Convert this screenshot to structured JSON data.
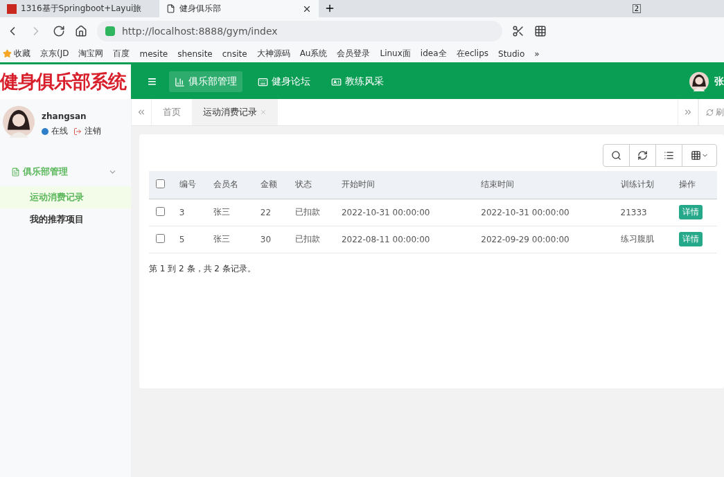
{
  "browser": {
    "tabs": [
      {
        "label": "1316基于Springboot+Layui旅",
        "selected": false
      },
      {
        "label": "健身俱乐部",
        "selected": true
      }
    ],
    "tab_count": "2",
    "address": "http://localhost:8888/gym/index",
    "bookmarks": [
      "收藏",
      "京东(JD",
      "淘宝网",
      "百度",
      "mesite",
      "shensite",
      "cnsite",
      "大神源码",
      "Au系统",
      "会员登录",
      "Linux面",
      "idea全",
      "在eclips",
      "Studio",
      "»"
    ]
  },
  "app": {
    "logo": "健身俱乐部系统",
    "menu_icon": "≡",
    "top_nav": [
      {
        "label": "俱乐部管理",
        "selected": true
      },
      {
        "label": "健身论坛",
        "selected": false
      },
      {
        "label": "教练风采",
        "selected": false
      }
    ],
    "user_name": "张",
    "sidebar": {
      "username": "zhangsan",
      "status": "在线",
      "logout": "注销",
      "items": [
        {
          "label": "俱乐部管理",
          "expanded": true,
          "children": [
            {
              "label": "运动消费记录",
              "selected": true
            },
            {
              "label": "我的推荐项目",
              "selected": false
            }
          ]
        }
      ]
    },
    "page_tabs": [
      {
        "label": "首页",
        "selected": false
      },
      {
        "label": "运动消费记录",
        "selected": true
      }
    ],
    "refresh": "刷",
    "table": {
      "select_all": false,
      "columns": [
        "编号",
        "会员名",
        "金额",
        "状态",
        "开始时间",
        "结束时间",
        "训练计划",
        "操作"
      ],
      "rows": [
        {
          "checked": false,
          "cells": [
            "3",
            "张三",
            "22",
            "已扣款",
            "2022-10-31 00:00:00",
            "2022-10-31 00:00:00",
            "21333"
          ],
          "action": "详情"
        },
        {
          "checked": false,
          "cells": [
            "5",
            "张三",
            "30",
            "已扣款",
            "2022-08-11 00:00:00",
            "2022-09-29 00:00:00",
            "练习腹肌"
          ],
          "action": "详情"
        }
      ],
      "summary": "第 1 到 2 条，共 2 条记录。"
    }
  }
}
